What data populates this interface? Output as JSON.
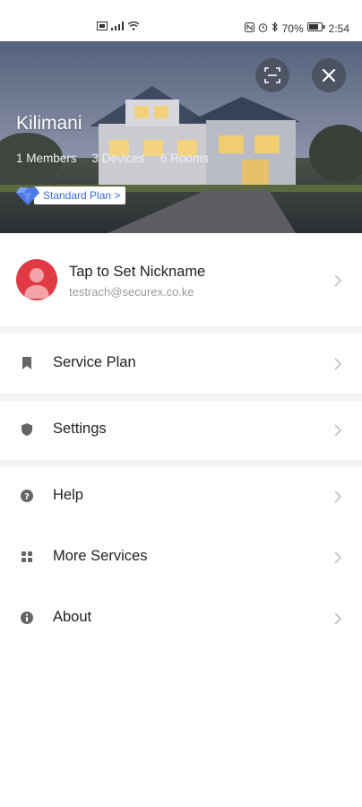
{
  "status_bar": {
    "left_icons": [
      "sim-icon",
      "signal-icon",
      "wifi-icon"
    ],
    "battery": "70%",
    "time": "2:54"
  },
  "home": {
    "name": "Kilimani",
    "stats": [
      "1 Members",
      "3 Devices",
      "6 Rooms"
    ],
    "plan_label": "Standard Plan >"
  },
  "profile": {
    "nickname_prompt": "Tap to Set Nickname",
    "email": "testrach@securex.co.ke"
  },
  "menu": [
    {
      "label": "Service Plan",
      "icon": "bookmark-icon"
    },
    {
      "label": "Settings",
      "icon": "shield-icon"
    },
    {
      "label": "Help",
      "icon": "help-icon"
    },
    {
      "label": "More Services",
      "icon": "grid-icon"
    },
    {
      "label": "About",
      "icon": "info-icon"
    }
  ],
  "colors": {
    "accent_blue": "#3a6bd8",
    "avatar_red": "#e23a44",
    "separator": "#f4f4f4"
  }
}
